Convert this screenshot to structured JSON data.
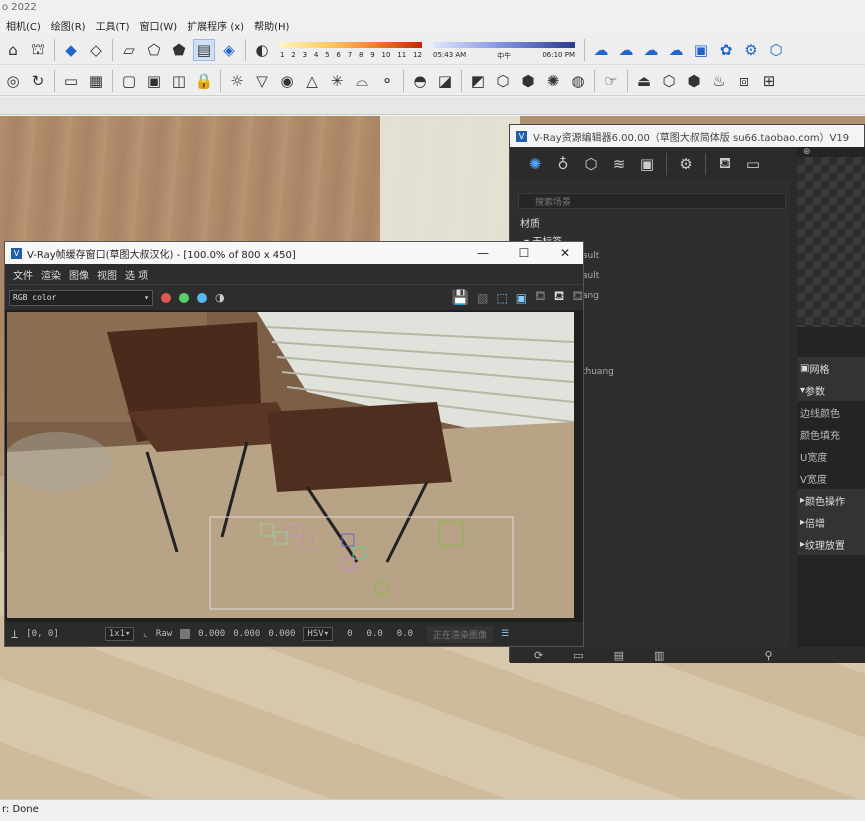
{
  "app": {
    "title_fragment": "o 2022",
    "status": "r: Done"
  },
  "menu": [
    "相机(C)",
    "绘图(R)",
    "工具(T)",
    "窗口(W)",
    "扩展程序 (x)",
    "帮助(H)"
  ],
  "toolbar": {
    "color_temp_numbers": [
      "1",
      "2",
      "3",
      "4",
      "5",
      "6",
      "7",
      "8",
      "9",
      "10",
      "11",
      "12"
    ],
    "sun_labels": [
      "05:43 AM",
      "中午",
      "06:10 PM"
    ]
  },
  "asset_editor": {
    "title": "V-Ray资源编辑器6.00.00（草图大叔简体版 su66.taobao.com）V19",
    "search_placeholder": "搜索场景",
    "section": "材质",
    "tree": [
      {
        "label": "无标签",
        "expanded": true
      },
      {
        "label": "ault"
      },
      {
        "label": "ault"
      },
      {
        "label": "ang"
      },
      {
        "label": "thuang"
      }
    ],
    "props": {
      "grid": "网格",
      "params": "参数",
      "edge_color": "边线颜色",
      "color_fill": "颜色填充",
      "u_width": "U宽度",
      "v_width": "V宽度",
      "color_ops": "颜色操作",
      "multiply": "倍增",
      "tex_place": "纹理放置"
    }
  },
  "vfb": {
    "title": "V-Ray帧缓存窗口(草图大叔汉化) - [100.0% of 800 x 450]",
    "menu": [
      "文件",
      "渲染",
      "图像",
      "视图",
      "选 项"
    ],
    "channel": "RGB color",
    "colors": {
      "red": "#e25555",
      "green": "#55d06a",
      "blue": "#5ab8f0"
    },
    "status": {
      "coords": "[0, 0]",
      "zoom": "1x1",
      "mode": "Raw",
      "rgb": [
        "0.000",
        "0.000",
        "0.000"
      ],
      "space": "HSV",
      "hsv": [
        "0",
        "0.0",
        "0.0"
      ],
      "render_button": "正在渲染图像"
    }
  }
}
